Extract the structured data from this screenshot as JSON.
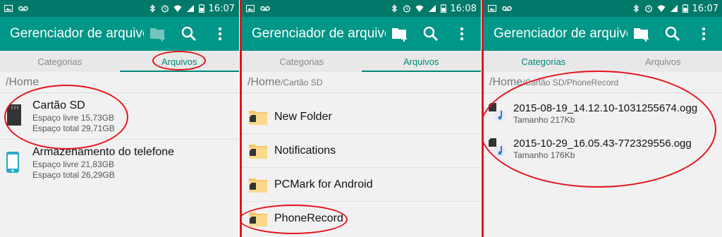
{
  "colors": {
    "primary": "#009688",
    "primary_dark": "#00796b",
    "accent": "#00897b",
    "annotation": "#e3131b"
  },
  "panels": [
    {
      "time": "16:07",
      "app_title": "Gerenciador de arquivos",
      "tabs": [
        "Categorias",
        "Arquivos"
      ],
      "path_root": "/Home",
      "path_rest": "",
      "storages": [
        {
          "name": "Cartão SD",
          "free": "Espaço livre 15,73GB",
          "total": "Espaço total 29,71GB",
          "icon": "sd-card-icon"
        },
        {
          "name": "Armazenamento do telefone",
          "free": "Espaço livre 21,83GB",
          "total": "Espaço total 26,29GB",
          "icon": "phone-icon"
        }
      ]
    },
    {
      "time": "16:08",
      "app_title": "Gerenciador de arquivos",
      "tabs": [
        "Categorias",
        "Arquivos"
      ],
      "path_root": "/Home",
      "path_rest": "/Cartão SD",
      "folders": [
        "New Folder",
        "Notifications",
        "PCMark for Android",
        "PhoneRecord"
      ]
    },
    {
      "time": "16:07",
      "app_title": "Gerenciador de arquivos",
      "tabs": [
        "Categorias",
        "Arquivos"
      ],
      "path_root": "/Home",
      "path_rest": "/Cartão SD/PhoneRecord",
      "files": [
        {
          "name": "2015-08-19_14.12.10-1031255674.ogg",
          "size": "Tamanho 217Kb"
        },
        {
          "name": "2015-10-29_16.05.43-772329556.ogg",
          "size": "Tamanho 176Kb"
        }
      ]
    }
  ]
}
